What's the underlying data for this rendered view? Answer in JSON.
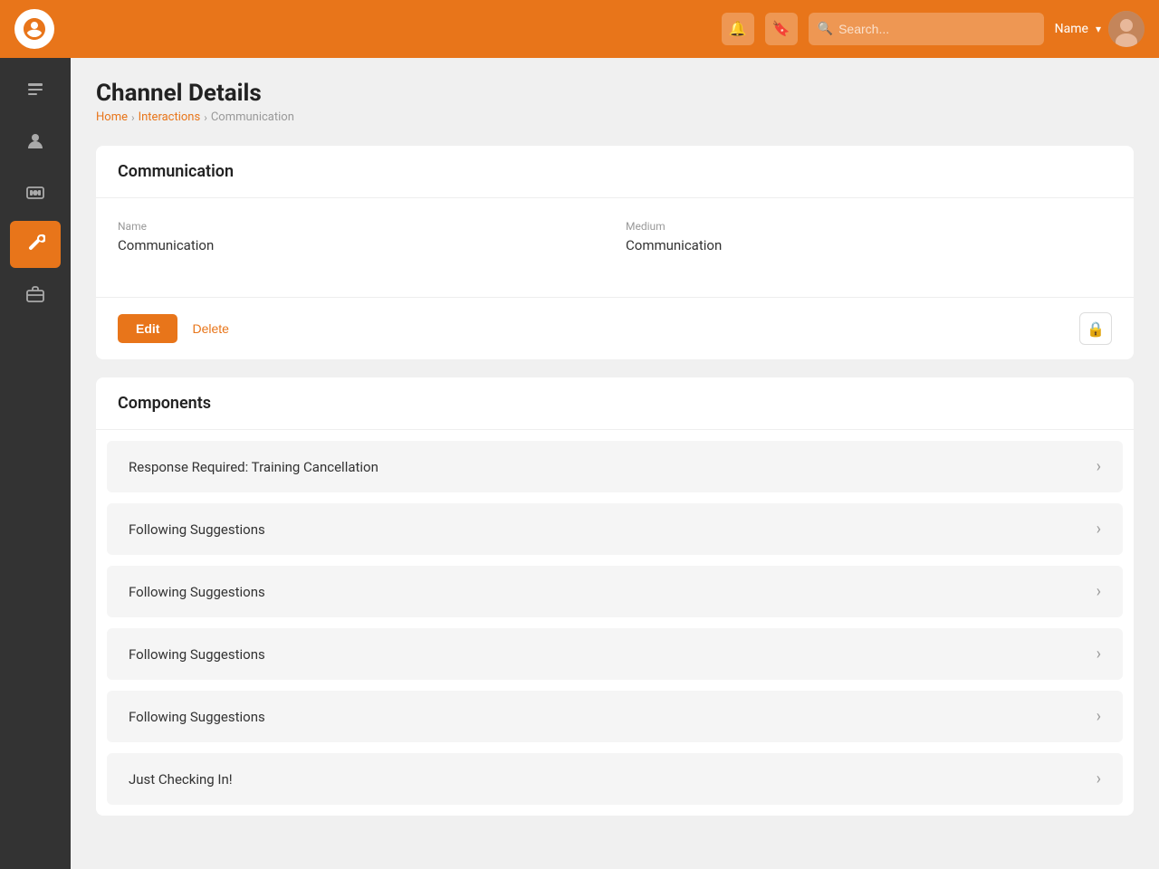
{
  "topnav": {
    "search_placeholder": "Search...",
    "user_name": "Name",
    "bell_icon": "🔔",
    "bookmark_icon": "🔖",
    "search_icon": "🔍",
    "chevron_icon": "▾"
  },
  "sidebar": {
    "items": [
      {
        "id": "notes",
        "icon": "≡",
        "label": "Notes"
      },
      {
        "id": "person",
        "icon": "👤",
        "label": "Person"
      },
      {
        "id": "money",
        "icon": "💰",
        "label": "Money"
      },
      {
        "id": "wrench",
        "icon": "🔧",
        "label": "Wrench",
        "active": true
      },
      {
        "id": "briefcase",
        "icon": "💼",
        "label": "Briefcase"
      }
    ]
  },
  "breadcrumb": {
    "home": "Home",
    "interactions": "Interactions",
    "current": "Communication"
  },
  "page": {
    "title": "Channel Details"
  },
  "channel_card": {
    "title": "Communication",
    "name_label": "Name",
    "name_value": "Communication",
    "medium_label": "Medium",
    "medium_value": "Communication",
    "edit_btn": "Edit",
    "delete_btn": "Delete"
  },
  "components": {
    "title": "Components",
    "items": [
      {
        "label": "Response Required: Training Cancellation"
      },
      {
        "label": "Following Suggestions"
      },
      {
        "label": "Following Suggestions"
      },
      {
        "label": "Following Suggestions"
      },
      {
        "label": "Following Suggestions"
      },
      {
        "label": "Just Checking In!"
      }
    ]
  }
}
